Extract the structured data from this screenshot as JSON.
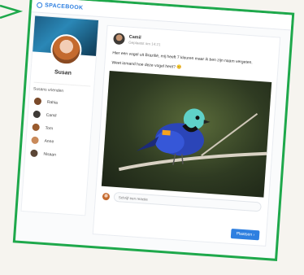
{
  "app": {
    "brand": "SPACEBOOK"
  },
  "profile": {
    "name": "Susan"
  },
  "friends": {
    "heading": "Susans vrienden",
    "items": [
      {
        "name": "Rahia",
        "color": "#7a4a2a"
      },
      {
        "name": "Camil",
        "color": "#3f3b37"
      },
      {
        "name": "Tom",
        "color": "#9a5b2e"
      },
      {
        "name": "Anne",
        "color": "#c98a5a"
      },
      {
        "name": "Nisaan",
        "color": "#5b4636"
      }
    ]
  },
  "post": {
    "author": "Camil",
    "time": "Geplaatst om 14:21",
    "text1": "Hier een vogel uit Brazilië, mij heeft 7 kleuren maar ik ben zijn naam vergeten.",
    "text2": "Weet iemand hoe deze vogel heet? 😊"
  },
  "comment": {
    "placeholder": "Schrijf een reactie"
  },
  "actions": {
    "post_label": "Plaatsen ›"
  },
  "colors": {
    "accent": "#2e7fe0",
    "highlight_frame": "#1ea84b"
  }
}
